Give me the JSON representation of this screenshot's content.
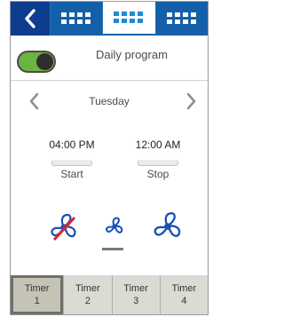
{
  "header": {
    "tabs": [
      {
        "icon": "chevron-left-icon"
      },
      {
        "icon": "grid-icon"
      },
      {
        "icon": "grid-icon",
        "active": true
      },
      {
        "icon": "grid-icon"
      }
    ]
  },
  "program": {
    "label": "Daily program",
    "enabled": true
  },
  "day": {
    "label": "Tuesday"
  },
  "schedule": {
    "start_time": "04:00 PM",
    "start_label": "Start",
    "stop_time": "12:00 AM",
    "stop_label": "Stop"
  },
  "fan_modes": [
    {
      "icon": "fan-off-icon"
    },
    {
      "icon": "fan-low-icon",
      "selected": true
    },
    {
      "icon": "fan-high-icon"
    }
  ],
  "timers": [
    {
      "label": "Timer",
      "number": "1"
    },
    {
      "label": "Timer",
      "number": "2"
    },
    {
      "label": "Timer",
      "number": "3"
    },
    {
      "label": "Timer",
      "number": "4"
    }
  ],
  "colors": {
    "header_blue": "#1460a8",
    "back_blue": "#0e3c8f",
    "toggle_green": "#6cb33f",
    "fan_blue": "#1a4fb8",
    "off_red": "#e0262a"
  }
}
